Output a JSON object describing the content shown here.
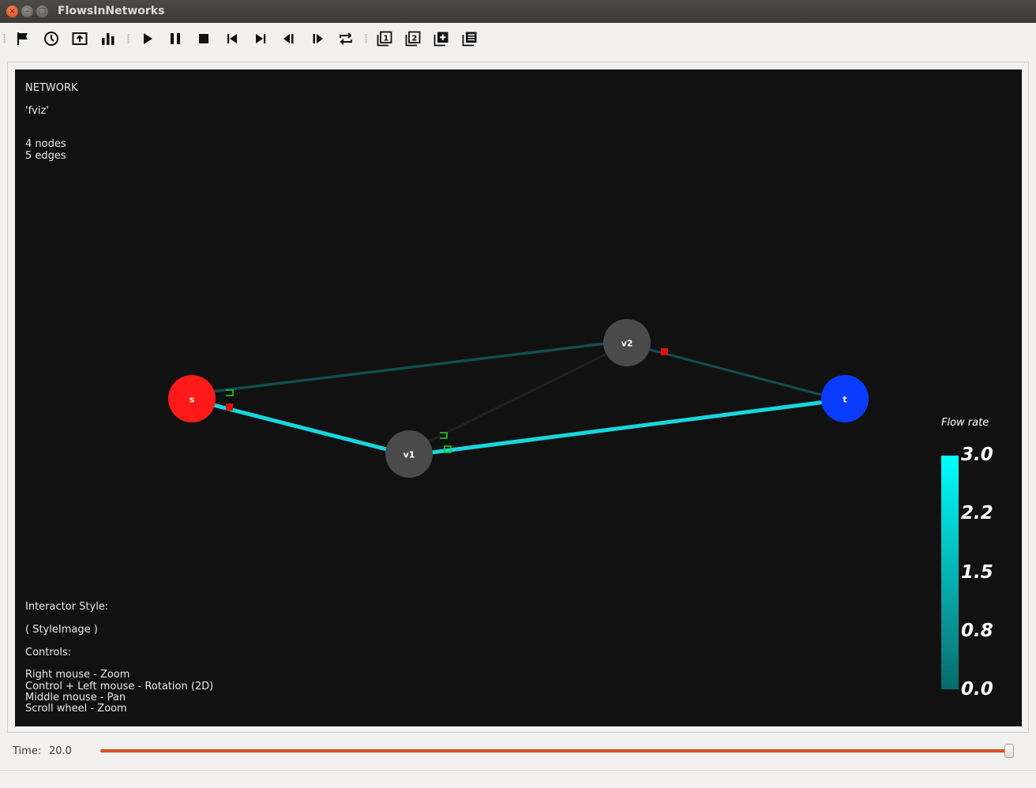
{
  "window": {
    "title": "FlowsInNetworks",
    "close_glyph": "×",
    "min_glyph": "–",
    "max_glyph": "□"
  },
  "toolbar": {
    "buttons": [
      {
        "icon": "flag-icon"
      },
      {
        "icon": "clock-icon"
      },
      {
        "icon": "upload-icon"
      },
      {
        "icon": "bar-chart-icon"
      },
      {
        "icon": "play-icon"
      },
      {
        "icon": "pause-icon"
      },
      {
        "icon": "stop-icon"
      },
      {
        "icon": "skip-to-start-icon"
      },
      {
        "icon": "skip-to-end-icon"
      },
      {
        "icon": "step-backward-icon"
      },
      {
        "icon": "step-forward-icon"
      },
      {
        "icon": "repeat-icon"
      },
      {
        "icon": "window-1-icon"
      },
      {
        "icon": "window-2-icon"
      },
      {
        "icon": "add-window-icon"
      },
      {
        "icon": "windows-list-icon"
      }
    ]
  },
  "viewport": {
    "heading": "NETWORK",
    "network_name": "'fviz'",
    "node_count": "4 nodes",
    "edge_count": "5 edges",
    "interactor_label": "Interactor Style:",
    "interactor_value": "( StyleImage )",
    "controls_label": "Controls:",
    "controls": [
      "Right mouse - Zoom",
      "Control + Left mouse - Rotation (2D)",
      "Middle mouse - Pan",
      "Scroll wheel - Zoom"
    ]
  },
  "graph": {
    "nodes": [
      {
        "id": "s",
        "label": "s",
        "color": "#ff1a1a"
      },
      {
        "id": "v1",
        "label": "v1",
        "color": "#4a4a4a"
      },
      {
        "id": "v2",
        "label": "v2",
        "color": "#4a4a4a"
      },
      {
        "id": "t",
        "label": "t",
        "color": "#0a3cff"
      }
    ],
    "edge_color_active": "#17d6dc",
    "edge_color_dim": "#0f4a4c",
    "marker_red": "#e01010",
    "marker_green": "#1fd11f"
  },
  "legend": {
    "title": "Flow rate",
    "ticks": [
      "3.0",
      "2.2",
      "1.5",
      "0.8",
      "0.0"
    ]
  },
  "timebar": {
    "label": "Time:",
    "value": "20.0",
    "position": 1.0
  }
}
